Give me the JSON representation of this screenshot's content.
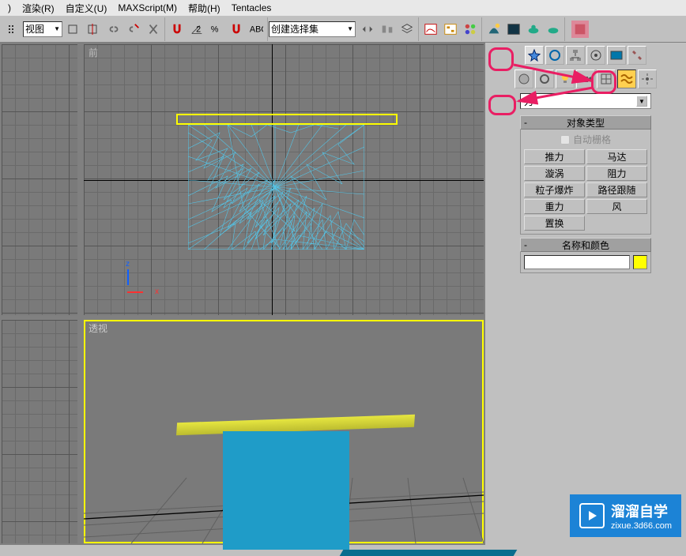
{
  "menu": {
    "render": "渲染(R)",
    "customize": "自定义(U)",
    "maxscript": "MAXScript(M)",
    "help": "帮助(H)",
    "tentacles": "Tentacles"
  },
  "toolbar": {
    "view_dropdown": "视图",
    "selection_set_dropdown": "创建选择集"
  },
  "viewports": {
    "front_label": "前",
    "perspective_label": "透视"
  },
  "command_panel": {
    "category_dropdown": "力",
    "rollout_object_type": "对象类型",
    "autogrid_label": "自动栅格",
    "buttons": {
      "push": "推力",
      "motor": "马达",
      "vortex": "漩涡",
      "drag": "阻力",
      "pbomb": "粒子爆炸",
      "path_follow": "路径跟随",
      "gravity": "重力",
      "wind": "风",
      "displace": "置换"
    },
    "rollout_name_color": "名称和颜色"
  },
  "watermark": {
    "main": "溜溜自学",
    "sub": "zixue.3d66.com"
  },
  "icons": {
    "arrow_down": "▼"
  }
}
